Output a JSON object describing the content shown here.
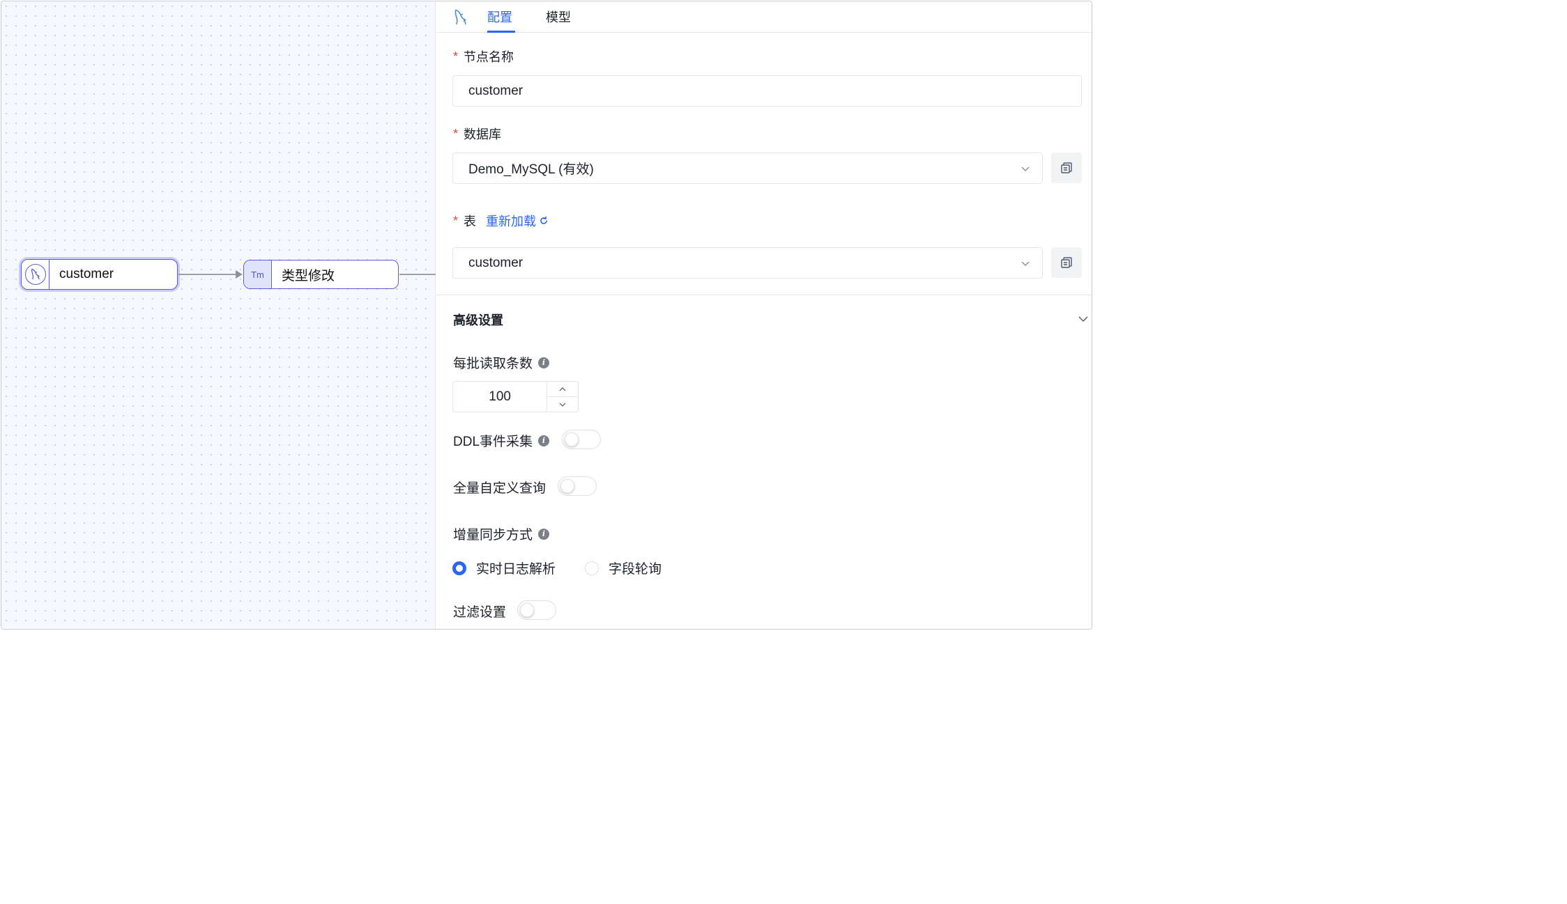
{
  "canvas": {
    "nodes": [
      {
        "label": "customer",
        "icon": "mysql-icon"
      },
      {
        "label": "类型修改",
        "icon_text": "Tm"
      }
    ]
  },
  "tabs": {
    "logo_icon": "mysql-dolphin-icon",
    "items": [
      {
        "label": "配置",
        "active": true
      },
      {
        "label": "模型",
        "active": false
      }
    ]
  },
  "form": {
    "node_name": {
      "label": "节点名称",
      "required": true,
      "value": "customer"
    },
    "database": {
      "label": "数据库",
      "required": true,
      "value": "Demo_MySQL (有效)"
    },
    "table": {
      "label": "表",
      "required": true,
      "reload_label": "重新加载",
      "value": "customer"
    },
    "required_mark": "*"
  },
  "advanced": {
    "title": "高级设置",
    "batch_read": {
      "label": "每批读取条数",
      "value": "100",
      "info": "i"
    },
    "ddl_collect": {
      "label": "DDL事件采集",
      "info": "i",
      "enabled": false
    },
    "full_custom_query": {
      "label": "全量自定义查询",
      "enabled": false
    },
    "incremental_sync": {
      "label": "增量同步方式",
      "info": "i",
      "options": [
        {
          "label": "实时日志解析",
          "checked": true
        },
        {
          "label": "字段轮询",
          "checked": false
        }
      ]
    },
    "filter": {
      "label": "过滤设置",
      "enabled": false
    }
  },
  "colors": {
    "accent": "#2c66f0",
    "node_border": "#5b5bd6",
    "required": "#f53f3f"
  }
}
